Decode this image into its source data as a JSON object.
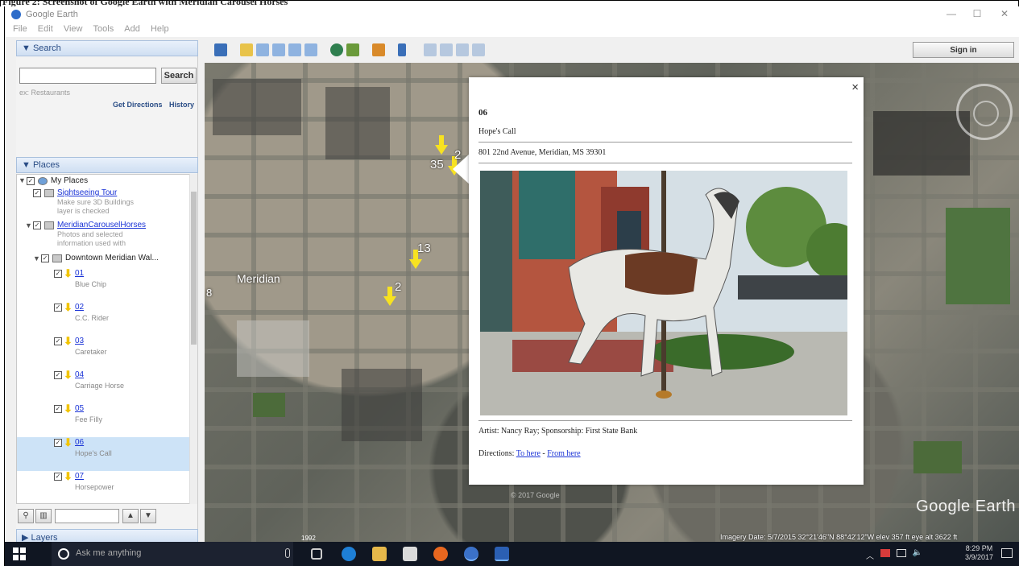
{
  "doc_strip": {
    "text": "Figure 2: Screenshot of Google Earth with Meridian Carousel Horses"
  },
  "window": {
    "title": "Google Earth",
    "controls": {
      "minimize": "—",
      "maximize": "☐",
      "close": "✕"
    }
  },
  "menu": [
    "File",
    "Edit",
    "View",
    "Tools",
    "Add",
    "Help"
  ],
  "search": {
    "header": "▼ Search",
    "placeholder": "",
    "value": "",
    "button": "Search",
    "hint": "ex: Restaurants",
    "get_directions": "Get Directions",
    "history": "History"
  },
  "places": {
    "header": "▼ Places",
    "my_places": "My Places",
    "sightseeing": {
      "label": "Sightseeing Tour",
      "desc": [
        "Make sure 3D Buildings",
        "layer is checked"
      ]
    },
    "meridian_carousel": {
      "label": "MeridianCarouselHorses",
      "desc": [
        "Photos and selected",
        "information used with"
      ]
    },
    "downtown": {
      "label": "Downtown Meridian Wal..."
    },
    "items": [
      {
        "num": "01",
        "name": "Blue Chip"
      },
      {
        "num": "02",
        "name": "C.C. Rider"
      },
      {
        "num": "03",
        "name": "Caretaker"
      },
      {
        "num": "04",
        "name": "Carriage Horse"
      },
      {
        "num": "05",
        "name": "Fee Filly"
      },
      {
        "num": "06",
        "name": "Hope's Call"
      },
      {
        "num": "07",
        "name": "Horsepower"
      }
    ],
    "selected_index": 5
  },
  "layers": {
    "header": "▶ Layers"
  },
  "toolbar": {
    "sign_in": "Sign in"
  },
  "map": {
    "place_label": "Meridian",
    "edge_label": "8",
    "pin_numbers": [
      "35",
      "2",
      "13",
      "2"
    ],
    "logo": "Google Earth",
    "imagery": "1992",
    "status": "Imagery Date: 5/7/2015  32°21'46\"N  88°42'12\"W  elev  357 ft     eye alt  3622 ft",
    "watermark": "© 2017 Google"
  },
  "balloon": {
    "close": "×",
    "number": "06",
    "title": "Hope's Call",
    "address": "801 22nd Avenue, Meridian, MS 39301",
    "artist": "Artist: Nancy Ray; Sponsorship: First State Bank",
    "directions_label": "Directions: ",
    "to_here": "To here",
    "separator": " - ",
    "from_here": "From here"
  },
  "taskbar": {
    "search_placeholder": "Ask me anything",
    "time": "8:29 PM",
    "date": "3/9/2017"
  },
  "colors": {
    "accent": "#2a4d86",
    "link": "#1a33d6",
    "pin": "#f7e221",
    "taskbar": "#101622",
    "selected_row": "#cde3f7"
  }
}
